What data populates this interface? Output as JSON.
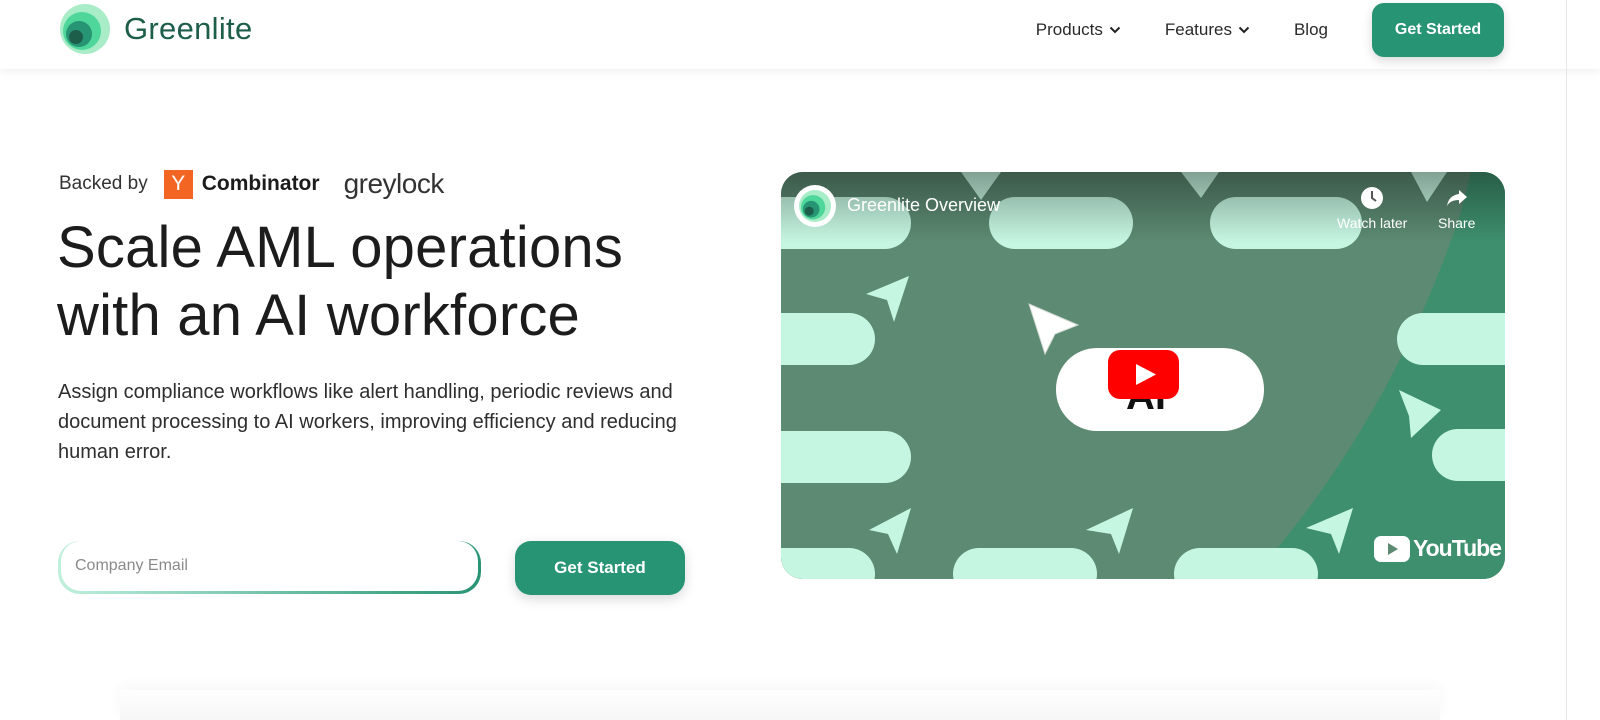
{
  "nav": {
    "brand": "Greenlite",
    "items": [
      {
        "label": "Products",
        "has_dropdown": true
      },
      {
        "label": "Features",
        "has_dropdown": true
      },
      {
        "label": "Blog",
        "has_dropdown": false
      }
    ],
    "cta_label": "Get Started",
    "logo_icon": "greenlite-logo-icon"
  },
  "hero": {
    "backed_by_label": "Backed by",
    "yc_mark": "Y",
    "yc_label": "Combinator",
    "greylock_label": "greylock",
    "headline_line1": "Scale AML operations",
    "headline_line2": "with an AI workforce",
    "subtext": "Assign compliance workflows like alert handling, periodic reviews and document processing to AI workers, improving efficiency and reducing human error.",
    "email_placeholder": "Company Email",
    "email_value": "",
    "cta_label": "Get Started"
  },
  "video": {
    "title": "Greenlite Overview",
    "watch_later_label": "Watch later",
    "share_label": "Share",
    "brand_label": "YouTube",
    "center_text": "AI",
    "icons": [
      "channel-avatar-icon",
      "clock-icon",
      "share-icon",
      "play-icon",
      "youtube-logo-icon"
    ]
  },
  "colors": {
    "brand_green": "#279473",
    "brand_dark": "#1d5e4a",
    "mint": "#c5f6e1",
    "video_bg": "#5c8a72",
    "yc_orange": "#f26522",
    "yt_red": "#ff0000"
  }
}
